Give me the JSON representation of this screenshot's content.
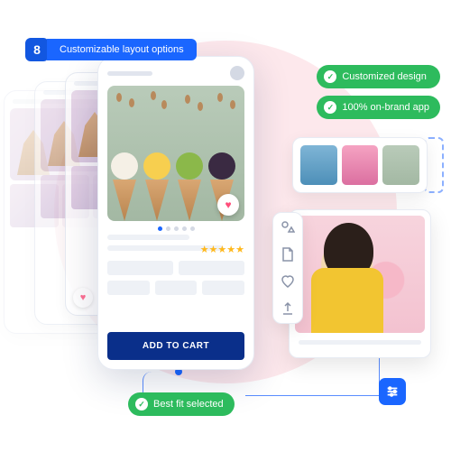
{
  "badge": {
    "number": "8",
    "label": "Customizable layout options"
  },
  "pills": {
    "design": "Customized design",
    "brand": "100% on-brand app",
    "bestfit": "Best fit selected"
  },
  "product": {
    "cta": "ADD TO CART",
    "rating_stars": "★★★★★"
  },
  "icons": {
    "check": "✓",
    "heart": "♥"
  }
}
